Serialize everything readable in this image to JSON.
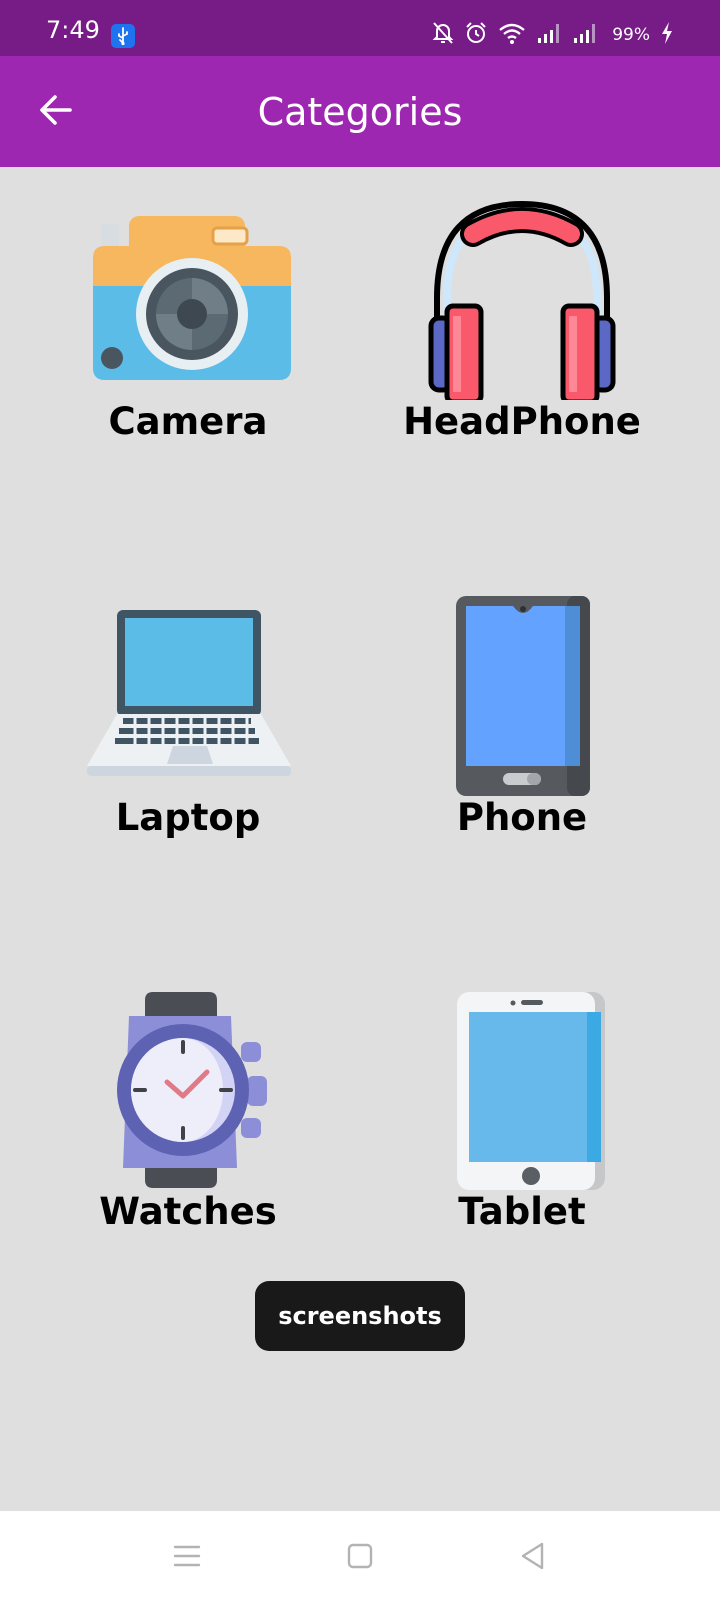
{
  "status_bar": {
    "time": "7:49",
    "battery": "99%",
    "icons": [
      "usb-icon",
      "bell-off-icon",
      "alarm-icon",
      "wifi-icon",
      "signal-icon",
      "signal-icon",
      "charging-icon"
    ]
  },
  "app_bar": {
    "title": "Categories",
    "back_icon": "arrow-left-icon"
  },
  "categories": [
    {
      "label": "Camera",
      "icon": "camera-icon"
    },
    {
      "label": "HeadPhone",
      "icon": "headphone-icon"
    },
    {
      "label": "Laptop",
      "icon": "laptop-icon"
    },
    {
      "label": "Phone",
      "icon": "phone-icon"
    },
    {
      "label": "Watches",
      "icon": "watch-icon"
    },
    {
      "label": "Tablet",
      "icon": "tablet-icon"
    }
  ],
  "toast": {
    "text": "screenshots"
  },
  "nav_bar": {
    "icons": [
      "menu-icon",
      "home-icon",
      "back-triangle-icon"
    ]
  },
  "colors": {
    "status_bar": "#771b86",
    "app_bar": "#9d27b0",
    "background": "#dfdfdf",
    "toast": "#191919"
  }
}
